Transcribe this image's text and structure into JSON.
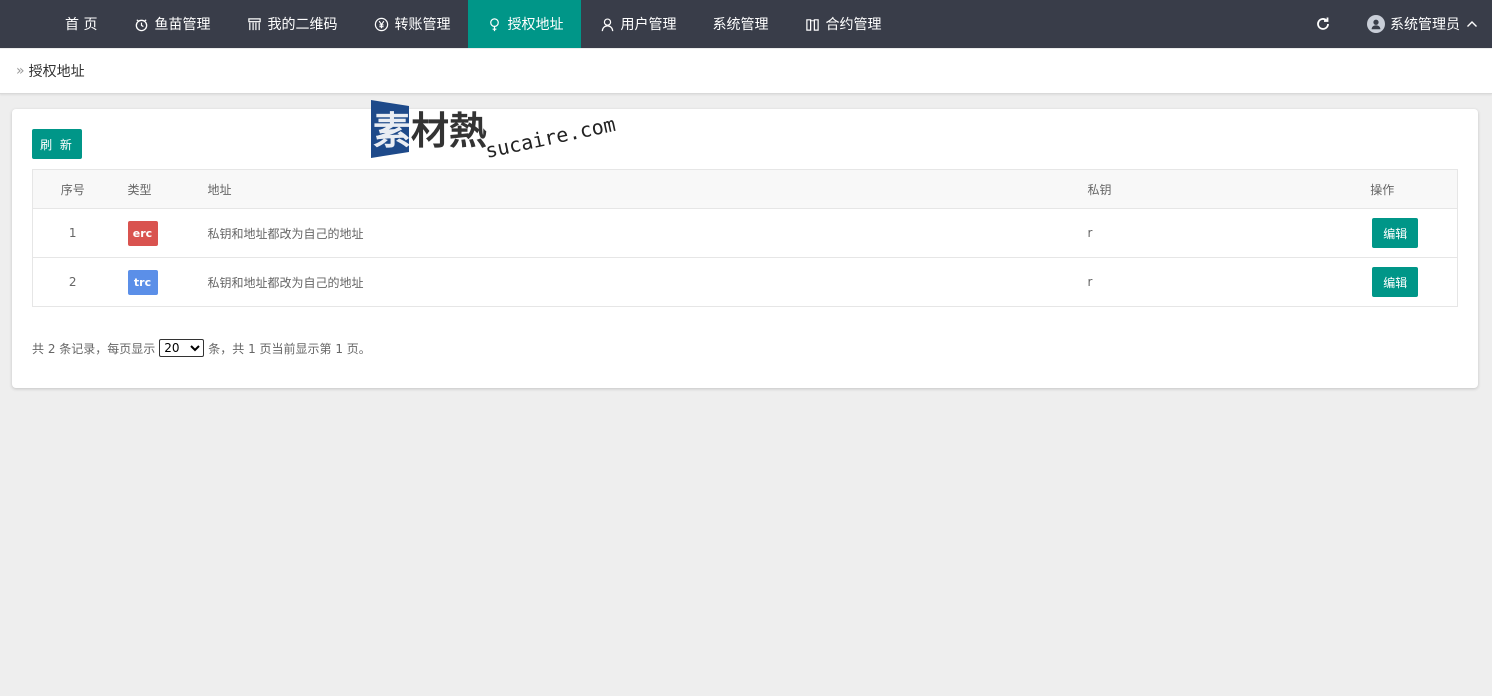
{
  "nav": {
    "items": [
      {
        "label": "首 页",
        "icon": "none"
      },
      {
        "label": "鱼苗管理",
        "icon": "clock-icon"
      },
      {
        "label": "我的二维码",
        "icon": "grid-icon"
      },
      {
        "label": "转账管理",
        "icon": "yen-icon"
      },
      {
        "label": "授权地址",
        "icon": "bulb-icon",
        "active": true
      },
      {
        "label": "用户管理",
        "icon": "user-icon"
      },
      {
        "label": "系统管理",
        "icon": "none"
      },
      {
        "label": "合约管理",
        "icon": "book-icon"
      }
    ],
    "user_name": "系统管理员"
  },
  "breadcrumb": {
    "current": "授权地址"
  },
  "toolbar": {
    "refresh_label": "刷 新"
  },
  "table": {
    "headers": [
      "序号",
      "类型",
      "地址",
      "私钥",
      "操作"
    ],
    "rows": [
      {
        "index": "1",
        "type": "erc",
        "type_color": "#d9534f",
        "address": "私钥和地址都改为自己的地址",
        "key": "r",
        "action": "编辑"
      },
      {
        "index": "2",
        "type": "trc",
        "type_color": "#5b8fe8",
        "address": "私钥和地址都改为自己的地址",
        "key": "r",
        "action": "编辑"
      }
    ]
  },
  "pager": {
    "prefix": "共 2 条记录，每页显示",
    "page_size": "20",
    "suffix": "条，共 1 页当前显示第 1 页。"
  },
  "watermark": {
    "cn": "素材熱",
    "en": "sucaire.com"
  },
  "colors": {
    "topbar": "#393d49",
    "accent": "#009688"
  }
}
